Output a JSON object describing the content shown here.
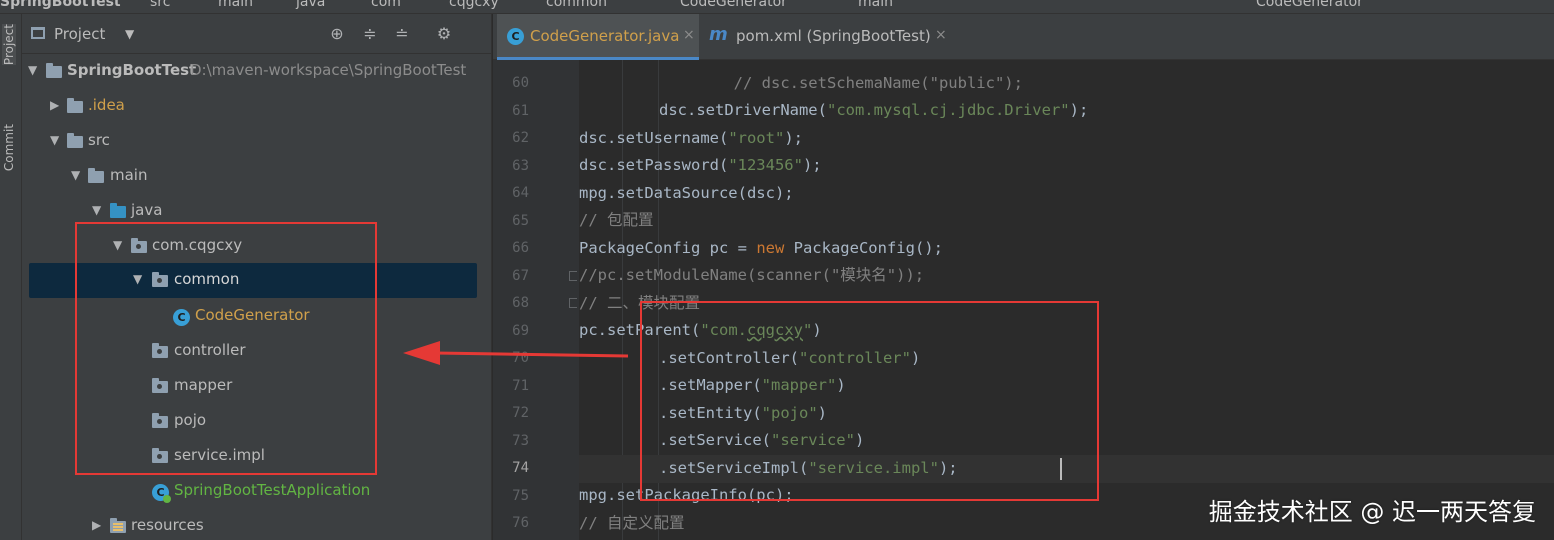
{
  "breadcrumb": [
    "SpringBootTest",
    "src",
    "main",
    "java",
    "com",
    "cqgcxy",
    "common",
    "CodeGenerator",
    "main"
  ],
  "run_config": "CodeGenerator",
  "toolstrip": {
    "project_label": "Project",
    "commit_label": "Commit"
  },
  "project_panel": {
    "title": "Project",
    "toolbar_icons": [
      "locate-icon",
      "expand-all-icon",
      "collapse-all-icon",
      "gear-icon"
    ],
    "tree": [
      {
        "label": "SpringBootTest",
        "path": "D:\\maven-workspace\\SpringBootTest"
      },
      {
        "label": ".idea"
      },
      {
        "label": "src"
      },
      {
        "label": "main"
      },
      {
        "label": "java"
      },
      {
        "label": "com.cqgcxy"
      },
      {
        "label": "common"
      },
      {
        "label": "CodeGenerator"
      },
      {
        "label": "controller"
      },
      {
        "label": "mapper"
      },
      {
        "label": "pojo"
      },
      {
        "label": "service.impl"
      },
      {
        "label": "SpringBootTestApplication"
      },
      {
        "label": "resources"
      }
    ]
  },
  "editor": {
    "tabs": [
      {
        "label": "CodeGenerator.java",
        "icon": "C",
        "active": true
      },
      {
        "label": "pom.xml (SpringBootTest)",
        "icon": "m",
        "active": false
      }
    ],
    "close_glyph": "×",
    "line_numbers": [
      "60",
      "61",
      "62",
      "63",
      "64",
      "65",
      "66",
      "67",
      "68",
      "69",
      "70",
      "71",
      "72",
      "73",
      "74",
      "75",
      "76"
    ],
    "current_line": "74",
    "code": {
      "l60": {
        "indent": "        ",
        "comment": "// dsc.setSchemaName(\"public\");"
      },
      "l61": {
        "indent": "        ",
        "pre": "dsc.setDriverName(",
        "str": "\"com.mysql.cj.jdbc.Driver\"",
        "post": ");"
      },
      "l62": {
        "pre": "dsc.setUsername(",
        "str": "\"root\"",
        "post": ");"
      },
      "l63": {
        "pre": "dsc.setPassword(",
        "str": "\"123456\"",
        "post": ");"
      },
      "l64": {
        "pre": "mpg.setDataSource(dsc);"
      },
      "l65": {
        "comment": "// 包配置"
      },
      "l66": {
        "pre": "PackageConfig pc = ",
        "kw": "new",
        "post": " PackageConfig();"
      },
      "l67": {
        "comment": "//pc.setModuleName(scanner(\"模块名\"));"
      },
      "l68": {
        "comment": "// 二、模块配置"
      },
      "l69": {
        "pre": "pc.setParent(",
        "str1": "\"com.",
        "squig": "cqgcxy",
        "str2": "\"",
        "post": ")"
      },
      "l70": {
        "indent": "        ",
        "pre": ".setController(",
        "str": "\"controller\"",
        "post": ")"
      },
      "l71": {
        "indent": "        ",
        "pre": ".setMapper(",
        "str": "\"mapper\"",
        "post": ")"
      },
      "l72": {
        "indent": "        ",
        "pre": ".setEntity(",
        "str": "\"pojo\"",
        "post": ")"
      },
      "l73": {
        "indent": "        ",
        "pre": ".setService(",
        "str": "\"service\"",
        "post": ")"
      },
      "l74": {
        "indent": "        ",
        "pre": ".setServiceImpl(",
        "str": "\"service.impl\"",
        "post": ");"
      },
      "l75": {
        "pre": "mpg.setPackageInfo(pc);"
      },
      "l76": {
        "comment": "// 自定义配置"
      }
    }
  },
  "watermark": "掘金技术社区 @ 迟一两天答复",
  "colors": {
    "annotation_red": "#e53935",
    "selection": "#0d293e",
    "string": "#6a8759",
    "keyword": "#cc7832",
    "comment": "#808080"
  }
}
